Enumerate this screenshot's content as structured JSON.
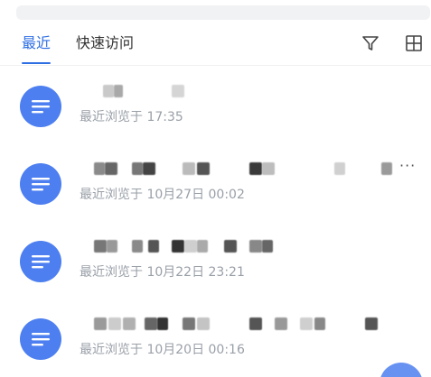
{
  "tabs": {
    "recent": "最近",
    "quick_access": "快速访问"
  },
  "files": [
    {
      "meta": "最近浏览于 17:35"
    },
    {
      "meta": "最近浏览于 10月27日 00:02",
      "more": "···"
    },
    {
      "meta": "最近浏览于 10月22日 23:21"
    },
    {
      "meta": "最近浏览于 10月20日 00:16"
    }
  ],
  "colors": {
    "accent": "#2f6fe4",
    "file_icon": "#4d7ff0",
    "meta_text": "#9aa0a8"
  }
}
